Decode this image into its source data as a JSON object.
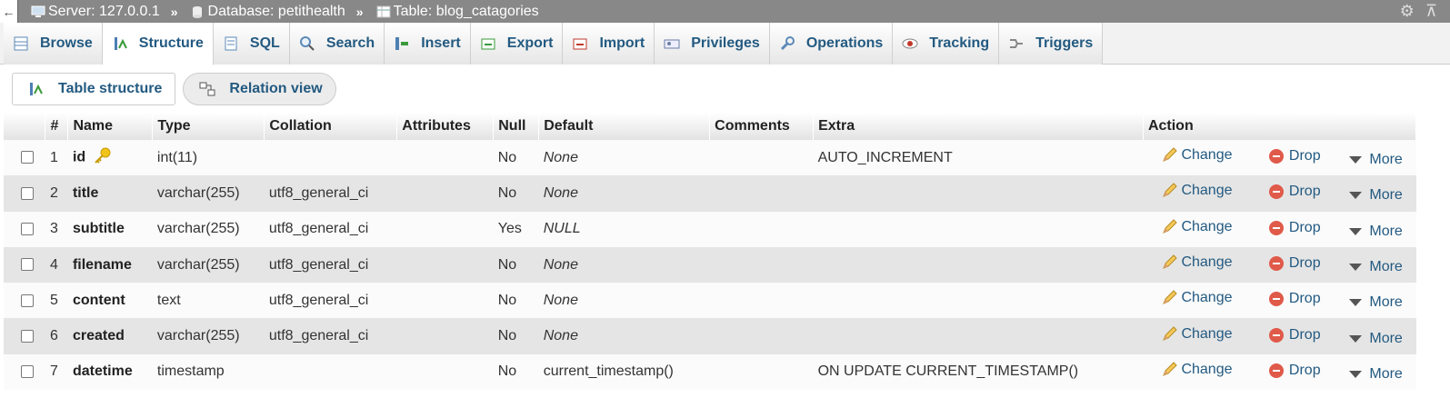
{
  "breadcrumb": {
    "back": "←",
    "server": "Server: 127.0.0.1",
    "separator": "»",
    "database": "Database: petithealth",
    "table": "Table: blog_catagories"
  },
  "topbar_icons": [
    "gear-icon",
    "collapse-icon"
  ],
  "tabs": [
    {
      "label": "Browse",
      "icon": "browse-icon"
    },
    {
      "label": "Structure",
      "icon": "structure-icon",
      "active": true
    },
    {
      "label": "SQL",
      "icon": "sql-icon"
    },
    {
      "label": "Search",
      "icon": "search-icon"
    },
    {
      "label": "Insert",
      "icon": "insert-icon"
    },
    {
      "label": "Export",
      "icon": "export-icon"
    },
    {
      "label": "Import",
      "icon": "import-icon"
    },
    {
      "label": "Privileges",
      "icon": "privileges-icon"
    },
    {
      "label": "Operations",
      "icon": "wrench-icon"
    },
    {
      "label": "Tracking",
      "icon": "eye-icon"
    },
    {
      "label": "Triggers",
      "icon": "triggers-icon"
    }
  ],
  "subnav": {
    "table_structure": "Table structure",
    "relation_view": "Relation view"
  },
  "table": {
    "headers": {
      "num": "#",
      "name": "Name",
      "type": "Type",
      "collation": "Collation",
      "attributes": "Attributes",
      "null": "Null",
      "default": "Default",
      "comments": "Comments",
      "extra": "Extra",
      "action": "Action"
    },
    "actions": {
      "change": "Change",
      "drop": "Drop",
      "more": "More"
    },
    "rows": [
      {
        "num": "1",
        "name": "id",
        "primary_key": true,
        "type": "int(11)",
        "collation": "",
        "attributes": "",
        "null": "No",
        "default": "None",
        "comments": "",
        "extra": "AUTO_INCREMENT"
      },
      {
        "num": "2",
        "name": "title",
        "type": "varchar(255)",
        "collation": "utf8_general_ci",
        "attributes": "",
        "null": "No",
        "default": "None",
        "comments": "",
        "extra": ""
      },
      {
        "num": "3",
        "name": "subtitle",
        "type": "varchar(255)",
        "collation": "utf8_general_ci",
        "attributes": "",
        "null": "Yes",
        "default": "NULL",
        "comments": "",
        "extra": ""
      },
      {
        "num": "4",
        "name": "filename",
        "type": "varchar(255)",
        "collation": "utf8_general_ci",
        "attributes": "",
        "null": "No",
        "default": "None",
        "comments": "",
        "extra": ""
      },
      {
        "num": "5",
        "name": "content",
        "type": "text",
        "collation": "utf8_general_ci",
        "attributes": "",
        "null": "No",
        "default": "None",
        "comments": "",
        "extra": ""
      },
      {
        "num": "6",
        "name": "created",
        "type": "varchar(255)",
        "collation": "utf8_general_ci",
        "attributes": "",
        "null": "No",
        "default": "None",
        "comments": "",
        "extra": ""
      },
      {
        "num": "7",
        "name": "datetime",
        "type": "timestamp",
        "collation": "",
        "attributes": "",
        "null": "No",
        "default": "current_timestamp()",
        "default_plain": true,
        "comments": "",
        "extra": "ON UPDATE CURRENT_TIMESTAMP()"
      }
    ]
  },
  "colors": {
    "link": "#235a81",
    "topbar": "#888888",
    "row_even": "#e5e5e5",
    "drop": "#e05a4a"
  }
}
